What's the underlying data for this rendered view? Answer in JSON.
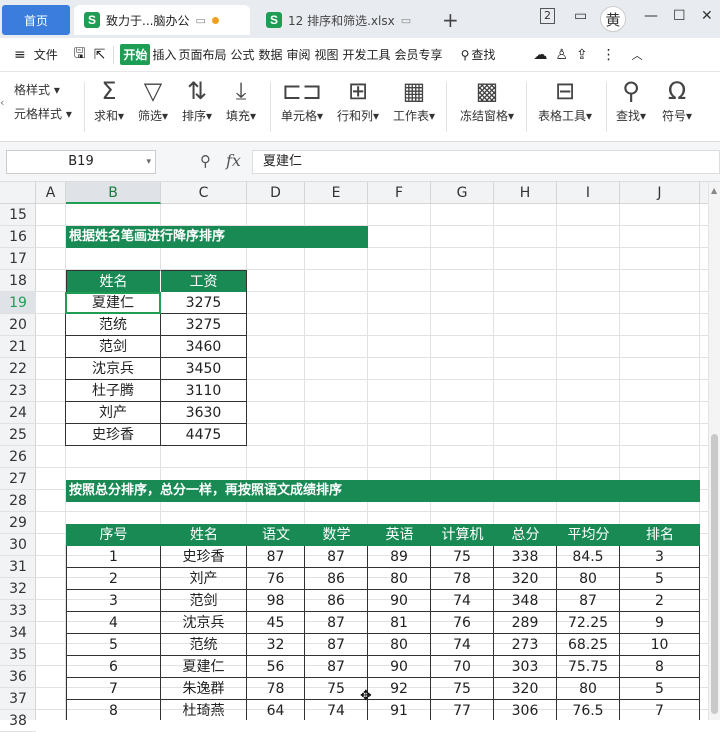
{
  "titlebar": {
    "home_tab": "首页",
    "doc_tab_1": "致力于...脑办公",
    "doc_tab_2": "12 排序和筛选.xlsx",
    "new_tab": "+",
    "avatar_char": "黄",
    "box_icon": "2",
    "minimize": "—",
    "maximize": "☐",
    "close": "✕"
  },
  "menubar": {
    "menu_icon": "≡",
    "file": "文件",
    "items": [
      "开始",
      "插入",
      "页面布局",
      "公式",
      "数据",
      "审阅",
      "视图",
      "开发工具",
      "会员专享"
    ],
    "search": "查找"
  },
  "ribbon": {
    "left_items": [
      "格样式",
      "元格样式"
    ],
    "buttons": [
      {
        "label": "求和",
        "icon": "sum-icon"
      },
      {
        "label": "筛选",
        "icon": "filter-icon"
      },
      {
        "label": "排序",
        "icon": "sort-icon"
      },
      {
        "label": "填充",
        "icon": "fill-icon"
      },
      {
        "label": "单元格",
        "icon": "cell-icon"
      },
      {
        "label": "行和列",
        "icon": "rows-cols-icon"
      },
      {
        "label": "工作表",
        "icon": "sheet-icon"
      },
      {
        "label": "冻结窗格",
        "icon": "freeze-icon"
      },
      {
        "label": "表格工具",
        "icon": "table-tools-icon"
      },
      {
        "label": "查找",
        "icon": "find-icon"
      },
      {
        "label": "符号",
        "icon": "symbol-icon"
      }
    ]
  },
  "formula_bar": {
    "name_box": "B19",
    "fx": "fx",
    "value": "夏建仁"
  },
  "columns": [
    "A",
    "B",
    "C",
    "D",
    "E",
    "F",
    "G",
    "H",
    "I",
    "J"
  ],
  "active_column": "B",
  "rows": [
    "15",
    "16",
    "17",
    "18",
    "19",
    "20",
    "21",
    "22",
    "23",
    "24",
    "25",
    "26",
    "27",
    "28",
    "29",
    "30",
    "31",
    "32",
    "33",
    "34",
    "35",
    "36",
    "37",
    "38"
  ],
  "active_row": "19",
  "table1": {
    "title": "根据姓名笔画进行降序排序",
    "headers": [
      "姓名",
      "工资"
    ],
    "rows": [
      [
        "夏建仁",
        "3275"
      ],
      [
        "范统",
        "3275"
      ],
      [
        "范剑",
        "3460"
      ],
      [
        "沈京兵",
        "3450"
      ],
      [
        "杜子腾",
        "3110"
      ],
      [
        "刘产",
        "3630"
      ],
      [
        "史珍香",
        "4475"
      ]
    ]
  },
  "table2": {
    "title": "按照总分排序，总分一样，再按照语文成绩排序",
    "headers": [
      "序号",
      "姓名",
      "语文",
      "数学",
      "英语",
      "计算机",
      "总分",
      "平均分",
      "排名"
    ],
    "rows": [
      [
        "1",
        "史珍香",
        "87",
        "87",
        "89",
        "75",
        "338",
        "84.5",
        "3"
      ],
      [
        "2",
        "刘产",
        "76",
        "86",
        "80",
        "78",
        "320",
        "80",
        "5"
      ],
      [
        "3",
        "范剑",
        "98",
        "86",
        "90",
        "74",
        "348",
        "87",
        "2"
      ],
      [
        "4",
        "沈京兵",
        "45",
        "87",
        "81",
        "76",
        "289",
        "72.25",
        "9"
      ],
      [
        "5",
        "范统",
        "32",
        "87",
        "80",
        "74",
        "273",
        "68.25",
        "10"
      ],
      [
        "6",
        "夏建仁",
        "56",
        "87",
        "90",
        "70",
        "303",
        "75.75",
        "8"
      ],
      [
        "7",
        "朱逸群",
        "78",
        "75",
        "92",
        "75",
        "320",
        "80",
        "5"
      ],
      [
        "8",
        "杜琦燕",
        "64",
        "74",
        "91",
        "77",
        "306",
        "76.5",
        "7"
      ]
    ]
  },
  "colors": {
    "accent_green": "#1a8a55",
    "home_tab_blue": "#3b7ddd"
  }
}
